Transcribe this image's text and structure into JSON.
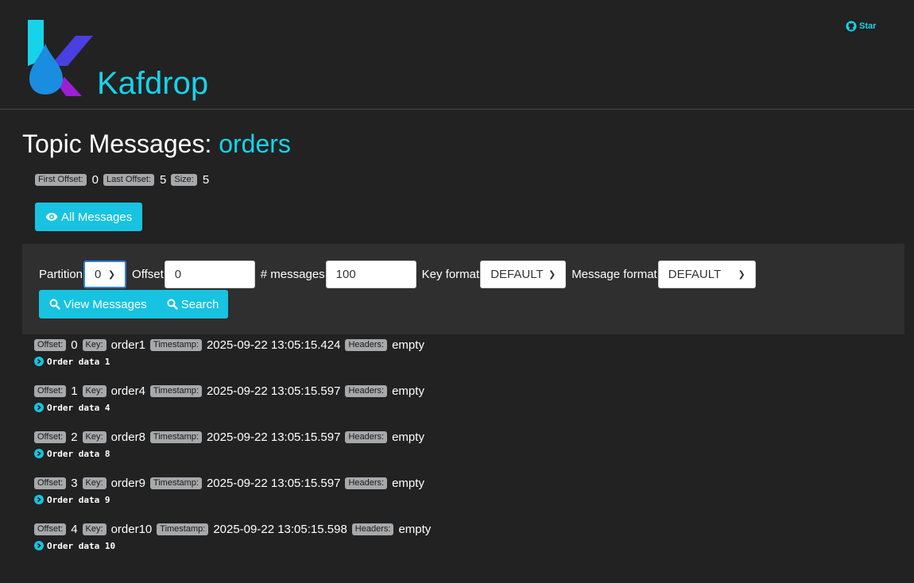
{
  "header": {
    "brand": "Kafdrop",
    "star_label": "Star",
    "icons": {
      "logo": "kafdrop-logo",
      "star": "github-icon"
    }
  },
  "page": {
    "title_prefix": "Topic Messages:",
    "topic": "orders"
  },
  "stats": {
    "first_offset_label": "First Offset:",
    "first_offset": "0",
    "last_offset_label": "Last Offset:",
    "last_offset": "5",
    "size_label": "Size:",
    "size": "5"
  },
  "all_messages_button": {
    "label": "All Messages",
    "icon": "eye-icon"
  },
  "filter": {
    "partition_label": "Partition",
    "partition_value": "0",
    "offset_label": "Offset",
    "offset_value": "0",
    "count_label": "# messages",
    "count_value": "100",
    "key_format_label": "Key format",
    "key_format_value": "DEFAULT",
    "message_format_label": "Message format",
    "message_format_value": "DEFAULT",
    "view_button": "View Messages",
    "search_button": "Search"
  },
  "labels": {
    "offset": "Offset:",
    "key": "Key:",
    "timestamp": "Timestamp:",
    "headers": "Headers:"
  },
  "messages": [
    {
      "offset": "0",
      "key": "order1",
      "timestamp": "2025-09-22 13:05:15.424",
      "headers": "empty",
      "body": "Order data 1"
    },
    {
      "offset": "1",
      "key": "order4",
      "timestamp": "2025-09-22 13:05:15.597",
      "headers": "empty",
      "body": "Order data 4"
    },
    {
      "offset": "2",
      "key": "order8",
      "timestamp": "2025-09-22 13:05:15.597",
      "headers": "empty",
      "body": "Order data 8"
    },
    {
      "offset": "3",
      "key": "order9",
      "timestamp": "2025-09-22 13:05:15.597",
      "headers": "empty",
      "body": "Order data 9"
    },
    {
      "offset": "4",
      "key": "order10",
      "timestamp": "2025-09-22 13:05:15.598",
      "headers": "empty",
      "body": "Order data 10"
    }
  ],
  "colors": {
    "accent": "#17d3ea",
    "button": "#17c3e0",
    "background": "#222222",
    "panel": "#2f2f2f",
    "badge": "#a6a8aa"
  }
}
